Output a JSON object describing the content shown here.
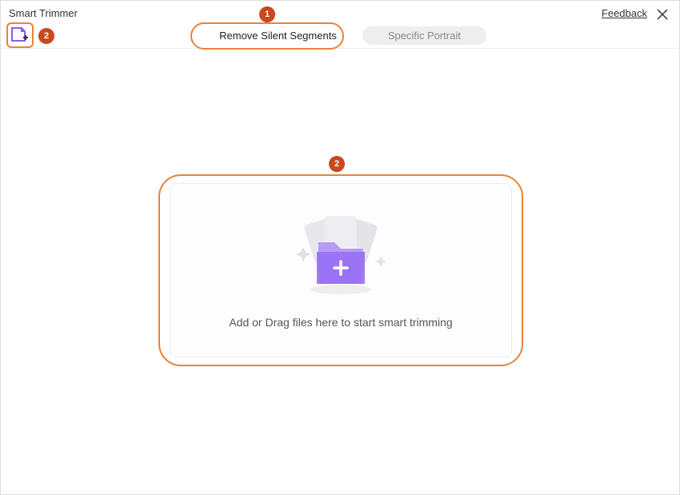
{
  "header": {
    "title": "Smart Trimmer",
    "feedback_label": "Feedback"
  },
  "tabs": {
    "active_label": "Remove Silent Segments",
    "inactive_label": "Specific Portrait"
  },
  "dropzone": {
    "text": "Add or Drag files here to start smart trimming"
  },
  "callouts": {
    "num1": "1",
    "num2a": "2",
    "num2b": "2"
  }
}
